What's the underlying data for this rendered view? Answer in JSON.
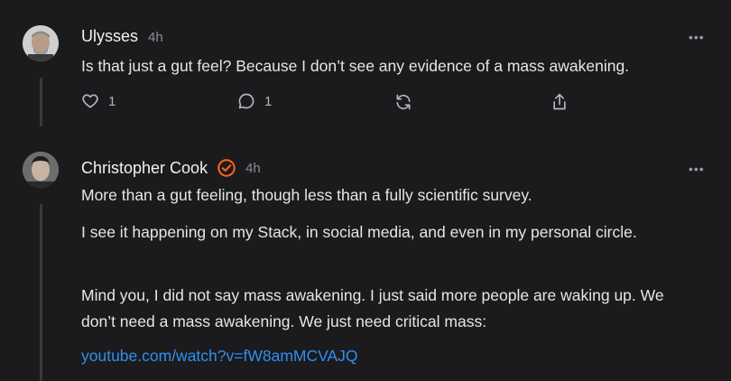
{
  "comments": [
    {
      "author": "Ulysses",
      "time": "4h",
      "text": "Is that just a gut feel? Because I don’t see any evidence of a mass awakening.",
      "likes": "1",
      "replies": "1"
    },
    {
      "author": "Christopher Cook",
      "time": "4h",
      "paragraphs": [
        "More than a gut feeling, though less than a fully scientific survey.",
        "I see it happening on my Stack, in social media, and even in my personal circle.",
        "Mind you, I did not say mass awakening. I just said more people are waking up. We don’t need a mass awakening. We just need critical mass:"
      ],
      "link": "youtube.com/watch?v=fW8amMCVAJQ"
    }
  ],
  "more_label": "•••",
  "icons": {
    "like": "heart-icon",
    "reply": "speech-bubble-icon",
    "restack": "restack-icon",
    "share": "share-icon",
    "verified": "verified-badge-icon"
  },
  "colors": {
    "background": "#1b1b1d",
    "link": "#2e8ff0",
    "verified": "#ff6719"
  }
}
